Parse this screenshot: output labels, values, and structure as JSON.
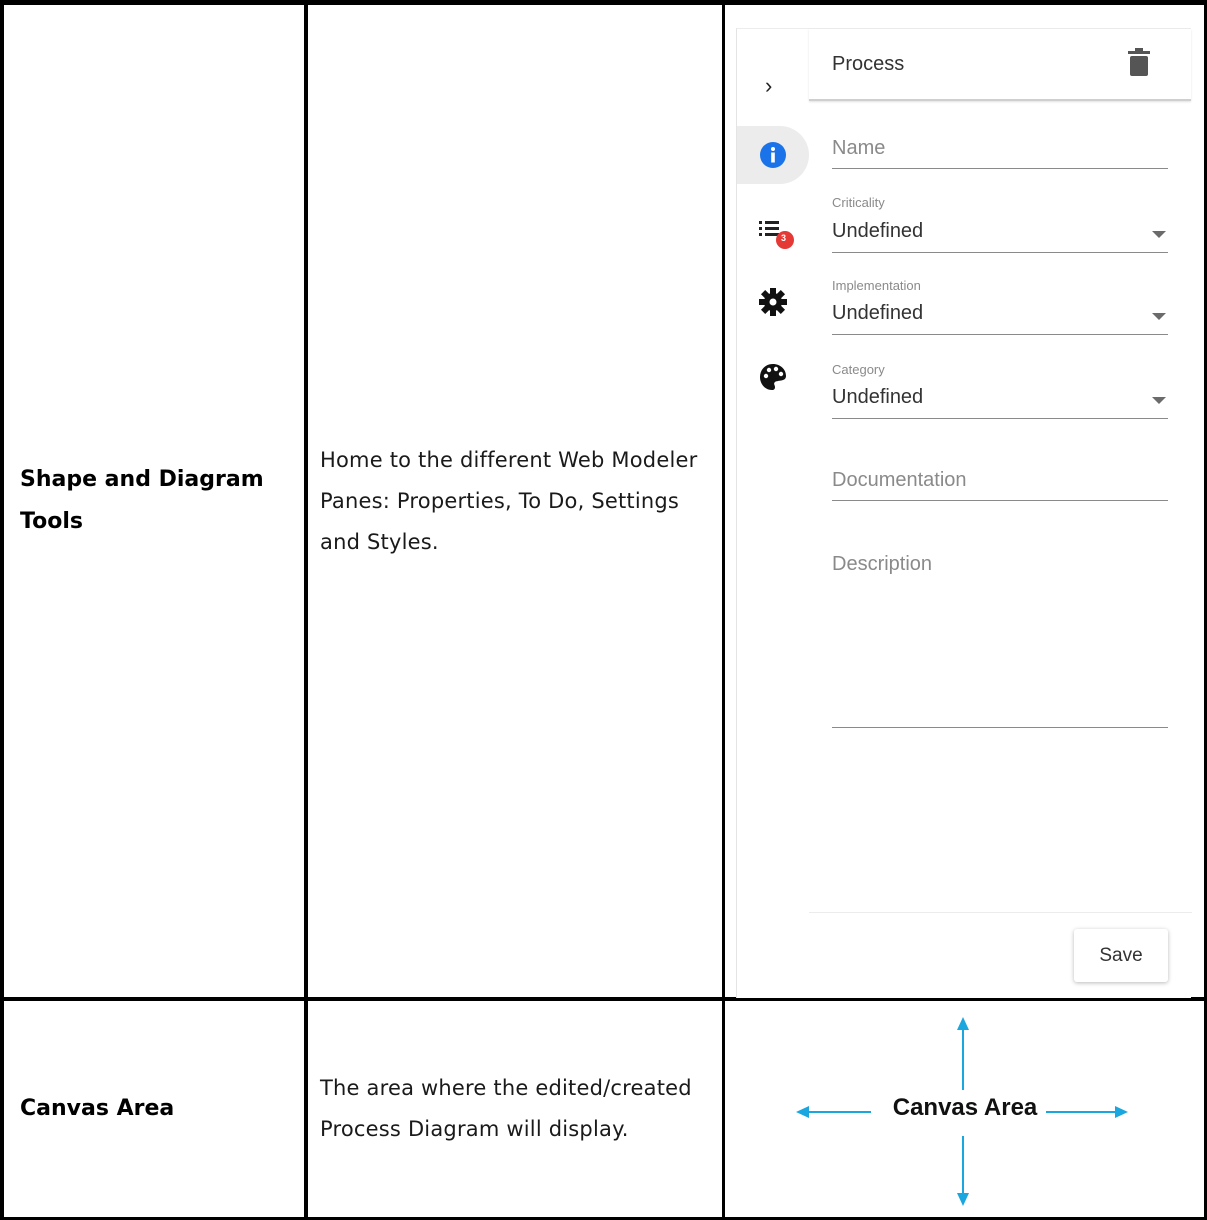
{
  "rows": [
    {
      "term": "Shape and Diagram Tools",
      "description": "Home to the different Web Modeler Panes: Properties, To Do, Settings and Styles."
    },
    {
      "term": "Canvas Area",
      "description": "The area where the edited/created Process Diagram will display."
    }
  ],
  "pane": {
    "title": "Process",
    "todo_badge": "3",
    "fields": {
      "name_placeholder": "Name",
      "criticality_label": "Criticality",
      "criticality_value": "Undefined",
      "implementation_label": "Implementation",
      "implementation_value": "Undefined",
      "category_label": "Category",
      "category_value": "Undefined",
      "documentation_placeholder": "Documentation",
      "description_placeholder": "Description"
    },
    "save_label": "Save",
    "colors": {
      "info_blue": "#1a73e8",
      "badge_red": "#e53935",
      "active_tab_bg": "#ececec"
    },
    "rail_icons": [
      "info-icon",
      "todo-list-icon",
      "settings-gear-icon",
      "palette-icon"
    ]
  },
  "canvas": {
    "label": "Canvas Area",
    "arrow_color": "#1aa7e0"
  }
}
